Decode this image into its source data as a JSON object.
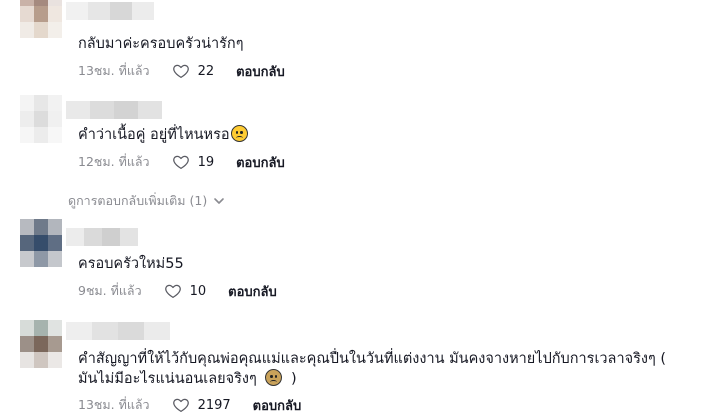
{
  "comments": [
    {
      "text": "กลับมาค่ะครอบครัวน่ารักๆ",
      "time": "13ชม. ที่แล้ว",
      "likes": "22",
      "reply": "ตอบกลับ",
      "emoji": false
    },
    {
      "text": "คำว่าเนื้อคู่ อยู่ที่ไหนหรอ",
      "time": "12ชม. ที่แล้ว",
      "likes": "19",
      "reply": "ตอบกลับ",
      "emoji": true
    },
    {
      "text": "ครอบครัวใหม่55",
      "time": "9ชม. ที่แล้ว",
      "likes": "10",
      "reply": "ตอบกลับ",
      "emoji": false
    },
    {
      "text_line1": "คำสัญญาที่ให้ไว้กับคุณพ่อคุณแม่และคุณปื่นในวันที่แต่งงาน มันคงจางหายไปกับการเวลาจริงๆ (",
      "text_line2": "มันไม่มีอะไรแน่นอนเลยจริงๆ",
      "text_line2_end": ")",
      "time": "13ชม. ที่แล้ว",
      "likes": "2197",
      "reply": "ตอบกลับ",
      "emoji": true
    }
  ],
  "more_replies": "ดูการตอบกลับเพิ่มเติม (1)",
  "icons": {
    "like": "heart-outline-icon",
    "expand": "chevron-down-icon",
    "emoji": "sad-face-emoji-icon"
  },
  "colors": {
    "text": "#161823",
    "muted": "#8a8b91"
  }
}
